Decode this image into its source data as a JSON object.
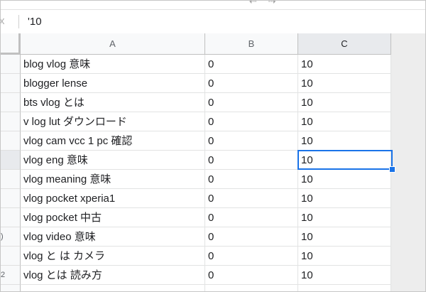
{
  "formula_bar": {
    "fx_label": "x",
    "value": "'10"
  },
  "top_arrows": "⇠ ⇢",
  "columns": [
    "A",
    "B",
    "C"
  ],
  "rows": [
    {
      "num": "",
      "a": "blog vlog 意味",
      "b": "0",
      "c": "10"
    },
    {
      "num": "",
      "a": "blogger lense",
      "b": "0",
      "c": "10"
    },
    {
      "num": "",
      "a": "bts vlog とは",
      "b": "0",
      "c": "10"
    },
    {
      "num": "",
      "a": "v log lut ダウンロード",
      "b": "0",
      "c": "10"
    },
    {
      "num": "",
      "a": "vlog cam vcc 1 pc 確認",
      "b": "0",
      "c": "10"
    },
    {
      "num": "",
      "a": "vlog eng 意味",
      "b": "0",
      "c": "10"
    },
    {
      "num": "",
      "a": "vlog meaning 意味",
      "b": "0",
      "c": "10"
    },
    {
      "num": "",
      "a": "vlog pocket xperia1",
      "b": "0",
      "c": "10"
    },
    {
      "num": "",
      "a": "vlog pocket 中古",
      "b": "0",
      "c": "10"
    },
    {
      "num": ")",
      "a": "vlog video 意味",
      "b": "0",
      "c": "10"
    },
    {
      "num": "",
      "a": "vlog と は カメラ",
      "b": "0",
      "c": "10"
    },
    {
      "num": "2",
      "a": "vlog とは 読み方",
      "b": "0",
      "c": "10"
    },
    {
      "num": "",
      "a": "",
      "b": "",
      "c": ""
    }
  ],
  "selected_cell": "C6",
  "colors": {
    "accent": "#1a73e8",
    "header_bg": "#f8f9fa"
  }
}
